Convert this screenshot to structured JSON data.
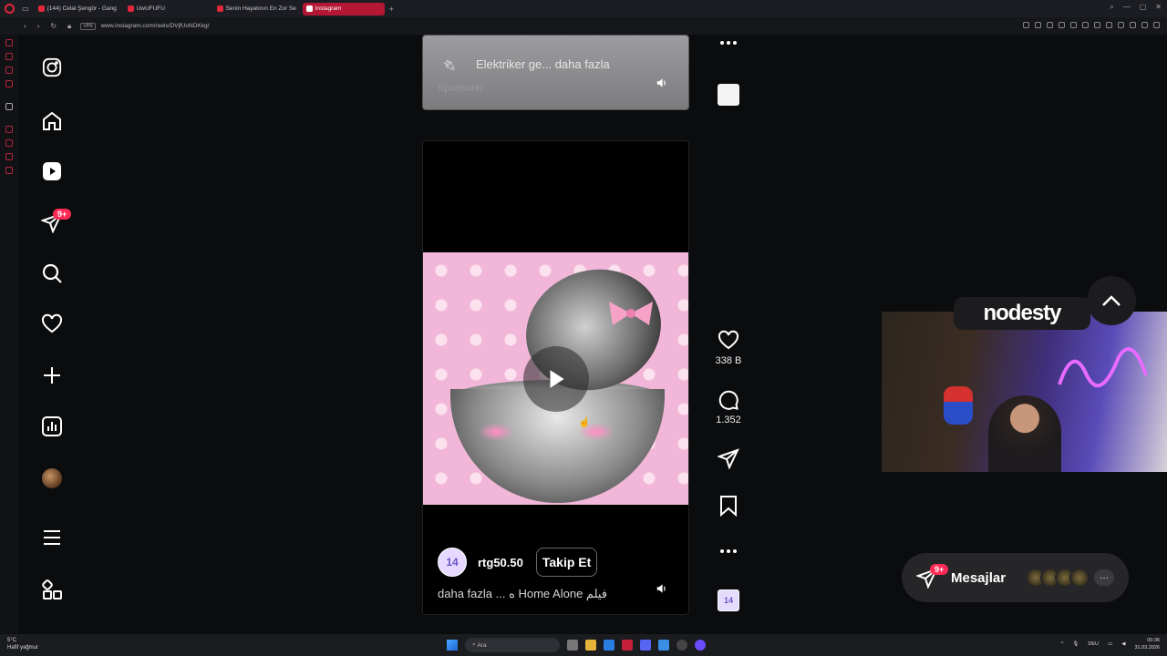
{
  "browser": {
    "tabs": [
      {
        "title": "(144) Celal Şengör - Gang",
        "color": "#e0283a"
      },
      {
        "title": "UwUFUFU",
        "color": "#e0283a"
      },
      {
        "title": "Senin Hayatının En Zor Se",
        "color": "#e0283a"
      },
      {
        "title": "Instagram",
        "color": "#ffffff"
      }
    ],
    "vpn_label": "VPN",
    "url": "www.instagram.com/reels/DVjfUoNDKkg/"
  },
  "sidebar": {
    "notifications_badge": "9+"
  },
  "ad_card": {
    "text": "Elektriker ge... daha fazla",
    "sponsored": "Sponsorlu"
  },
  "reel": {
    "username": "rtg50.50",
    "avatar_text": "14",
    "follow_label": "Takip Et",
    "caption": "daha fazla ... ه Home Alone فيلم",
    "likes": "338 B",
    "comments": "1.352"
  },
  "stream_overlay": {
    "logo_text": "nodesty"
  },
  "messages": {
    "label": "Mesajlar",
    "badge": "9+"
  },
  "taskbar": {
    "temperature": "5°C",
    "weather": "Hafif yağmur",
    "search_placeholder": "Ara",
    "language": "DEU",
    "time": "00:36",
    "date": "31.03.2026"
  },
  "colors": {
    "accent": "#ff2b55",
    "opera_red": "#b31734",
    "background": "#0b0c0e"
  }
}
